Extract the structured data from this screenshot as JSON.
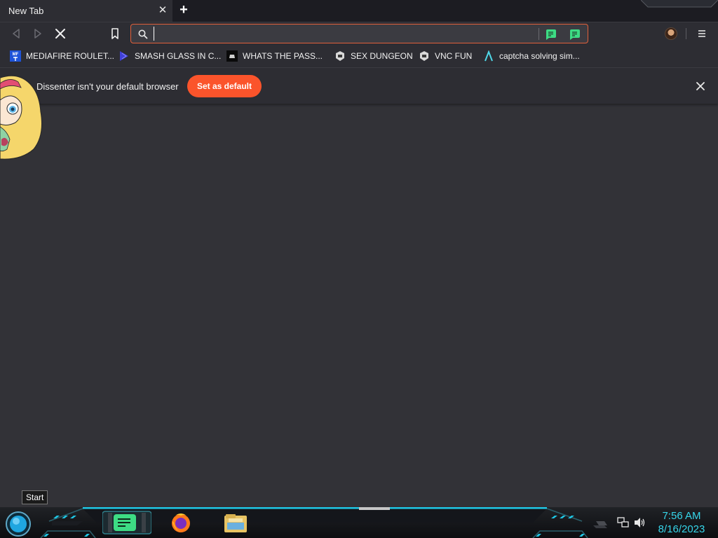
{
  "tab": {
    "title": "New Tab",
    "close_glyph": "✕"
  },
  "new_tab_glyph": "+",
  "toolbar": {
    "back_icon": "back-icon",
    "forward_icon": "forward-icon",
    "stop_icon": "stop-icon",
    "bookmark_icon": "bookmark-icon",
    "omnibox": {
      "value": "",
      "placeholder": ""
    },
    "extensions": [
      "dissenter-icon",
      "dissenter-comment-icon"
    ],
    "menu_icon": "hamburger-menu-icon"
  },
  "bookmarks": [
    {
      "label": "MEDIAFIRE ROULET...",
      "icon": "mediafire-icon"
    },
    {
      "label": "SMASH GLASS IN C...",
      "icon": "sigma-icon"
    },
    {
      "label": "WHATS THE PASS...",
      "icon": "dark-site-icon"
    },
    {
      "label": "SEX DUNGEON",
      "icon": "game-icon"
    },
    {
      "label": "VNC FUN",
      "icon": "game-icon"
    },
    {
      "label": "captcha solving sim...",
      "icon": "lambda-icon"
    }
  ],
  "infobar": {
    "message": "Dissenter isn't your default browser",
    "button": "Set as default",
    "close_glyph": "✕"
  },
  "tooltip": {
    "text": "Start"
  },
  "taskbar": {
    "apps": [
      "notes-app-icon",
      "firefox-icon",
      "file-explorer-icon"
    ],
    "tray": [
      "network-icon",
      "volume-icon"
    ]
  },
  "clock": {
    "time": "7:56 AM",
    "date": "8/16/2023"
  },
  "colors": {
    "accent": "#fb542b",
    "omnibox_border": "#e2603a",
    "ext_green": "#3ddc84",
    "taskbar_cyan": "#1ec8e6"
  }
}
